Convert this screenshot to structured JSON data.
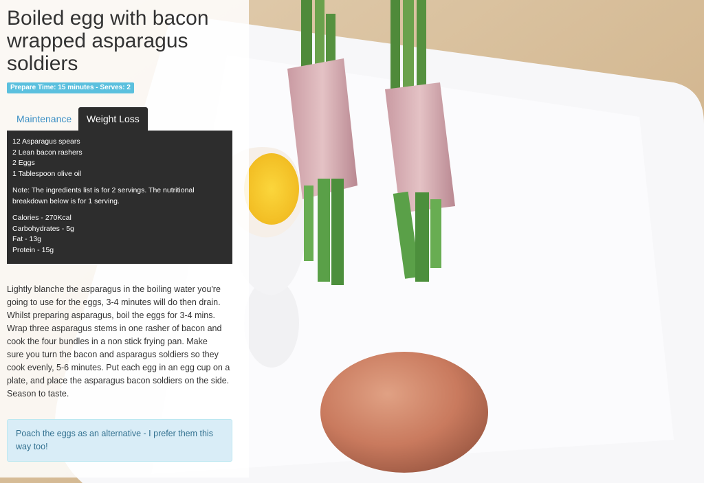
{
  "recipe": {
    "title": "Boiled egg with bacon wrapped asparagus soldiers",
    "meta": "Prepare Time: 15 minutes - Serves: 2",
    "tabs": [
      {
        "label": "Maintenance",
        "active": false
      },
      {
        "label": "Weight Loss",
        "active": true
      }
    ],
    "ingredients": [
      "12 Asparagus spears",
      "2 Lean bacon rashers",
      "2 Eggs",
      "1 Tablespoon olive oil"
    ],
    "note_lines": [
      "Note: The ingredients list is for 2 servings. The nutritional",
      "breakdown below is for 1 serving."
    ],
    "nutrition": [
      "Calories - 270Kcal",
      "Carbohydrates - 5g",
      "Fat - 13g",
      "Protein - 15g"
    ],
    "method_lines": [
      "Lightly blanche the asparagus in the boiling water you're",
      "going to use for the eggs, 3-4 minutes will do then drain.",
      "Whilst preparing asparagus, boil the eggs for 3-4 mins.",
      "Wrap three asparagus stems in one rasher of bacon and",
      "cook the four bundles in a non stick frying pan. Make",
      "sure you turn the bacon and asparagus soldiers so they",
      "cook evenly, 5-6 minutes. Put each egg in an egg cup on a",
      "plate, and place the asparagus bacon soldiers on the side.",
      "Season to taste."
    ],
    "tip_lines": [
      "Poach the eggs as an alternative - I prefer them this",
      "way too!"
    ]
  },
  "colors": {
    "badge": "#5bc0de",
    "active_tab": "#2d2d2d",
    "link": "#3b8fc4",
    "tip_bg": "#d9edf7",
    "tip_text": "#31708f"
  }
}
